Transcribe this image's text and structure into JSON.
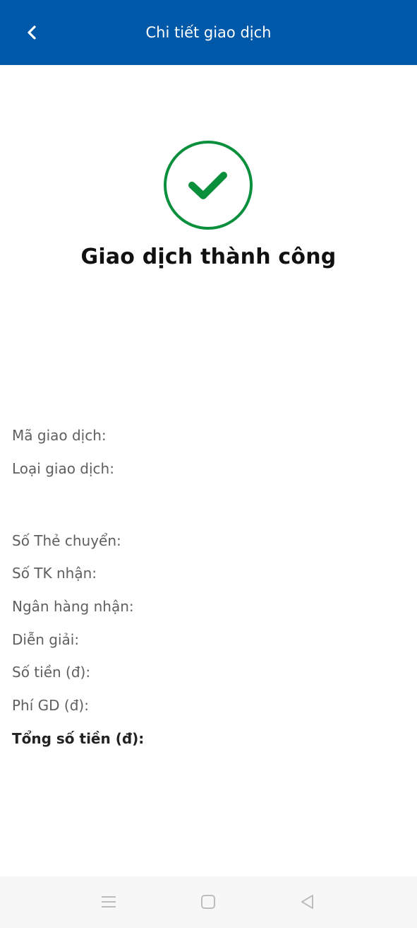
{
  "header": {
    "title": "Chi tiết giao dịch",
    "background_color": "#0058a8",
    "back_icon": "chevron-left-icon"
  },
  "status": {
    "icon": "check-circle-icon",
    "icon_color": "#0a8f3c",
    "title": "Giao dịch thành công"
  },
  "details": {
    "transaction_id_label": "Mã giao dịch:",
    "transaction_type_label": "Loại giao dịch:",
    "source_card_label": "Số Thẻ chuyển:",
    "destination_account_label": "Số TK nhận:",
    "destination_bank_label": "Ngân hàng nhận:",
    "description_label": "Diễn giải:",
    "amount_label": "Số tiền (đ):",
    "fee_label": "Phí GD (đ):",
    "total_label": "Tổng số tiền (đ):"
  },
  "nav_bar": {
    "menu_icon": "menu-icon",
    "home_icon": "home-square-icon",
    "back_icon": "back-triangle-icon"
  }
}
